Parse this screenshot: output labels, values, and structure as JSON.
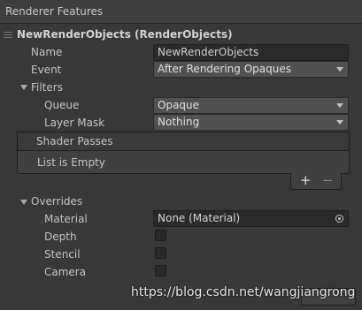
{
  "header": {
    "title": "Renderer Features"
  },
  "feature": {
    "title": "NewRenderObjects (RenderObjects)",
    "name_label": "Name",
    "name_value": "NewRenderObjects",
    "event_label": "Event",
    "event_value": "After Rendering Opaques"
  },
  "filters": {
    "label": "Filters",
    "queue_label": "Queue",
    "queue_value": "Opaque",
    "layer_mask_label": "Layer Mask",
    "layer_mask_value": "Nothing"
  },
  "shader_passes": {
    "header": "Shader Passes",
    "empty_text": "List is Empty",
    "add_glyph": "+",
    "remove_glyph": "−"
  },
  "overrides": {
    "label": "Overrides",
    "material_label": "Material",
    "material_value": "None (Material)",
    "depth_label": "Depth",
    "depth_checked": false,
    "stencil_label": "Stencil",
    "stencil_checked": false,
    "camera_label": "Camera",
    "camera_checked": false
  },
  "watermark": "https://blog.csdn.net/wangjiangrong",
  "icons": {
    "drag": "drag-handle-icon",
    "dropdown": "chevron-down-icon",
    "foldout": "foldout-arrow-icon",
    "picker": "object-picker-icon"
  }
}
